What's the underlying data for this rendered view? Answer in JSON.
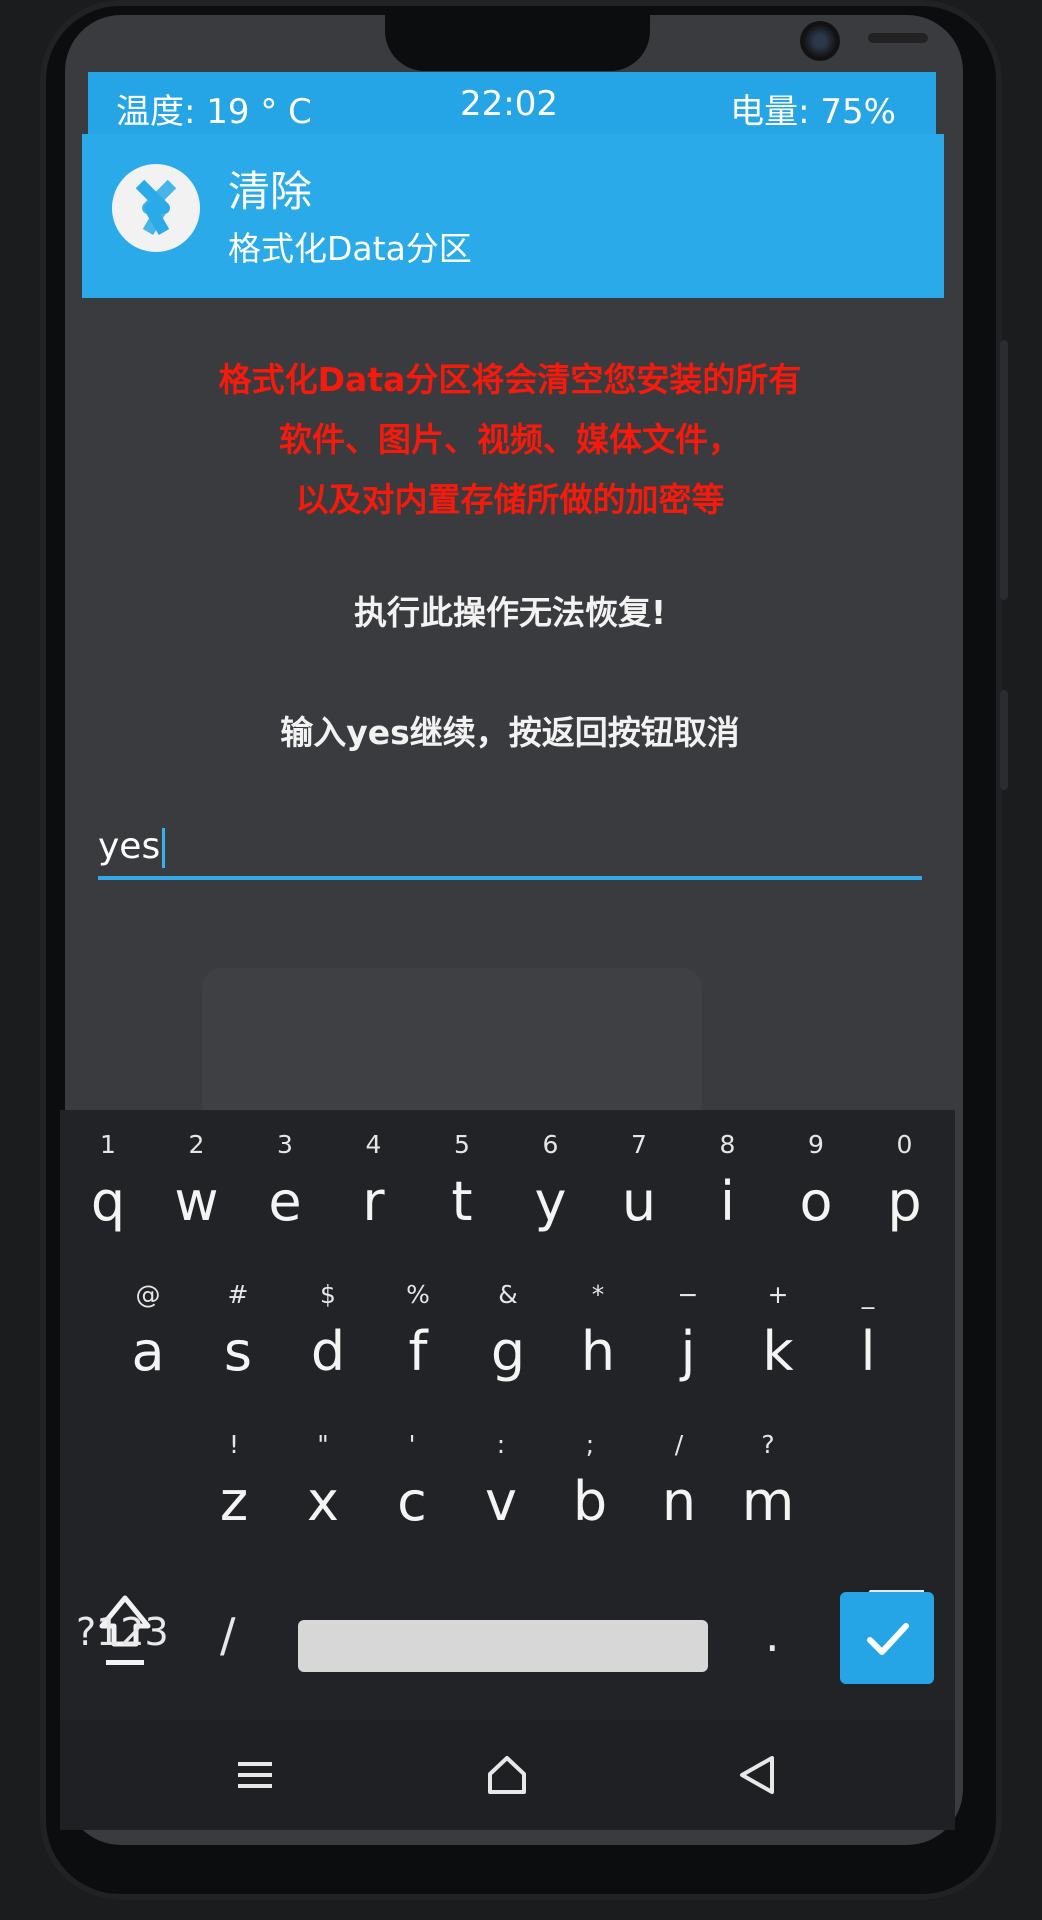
{
  "status_bar": {
    "temperature": "温度: 19 ° C",
    "time": "22:02",
    "battery": "电量: 75%"
  },
  "header": {
    "title": "清除",
    "subtitle": "格式化Data分区",
    "logo_icon": "twrp-logo-icon"
  },
  "content": {
    "warning_lines": [
      "格式化Data分区将会清空您安装的所有",
      "软件、图片、视频、媒体文件，",
      "以及对内置存储所做的加密等"
    ],
    "irreversible": "执行此操作无法恢复!",
    "instruction": "输入yes继续，按返回按钮取消",
    "input_value": "yes"
  },
  "keyboard": {
    "row1": [
      {
        "hint": "1",
        "key": "q"
      },
      {
        "hint": "2",
        "key": "w"
      },
      {
        "hint": "3",
        "key": "e"
      },
      {
        "hint": "4",
        "key": "r"
      },
      {
        "hint": "5",
        "key": "t"
      },
      {
        "hint": "6",
        "key": "y"
      },
      {
        "hint": "7",
        "key": "u"
      },
      {
        "hint": "8",
        "key": "i"
      },
      {
        "hint": "9",
        "key": "o"
      },
      {
        "hint": "0",
        "key": "p"
      }
    ],
    "row2": [
      {
        "hint": "@",
        "key": "a"
      },
      {
        "hint": "#",
        "key": "s"
      },
      {
        "hint": "$",
        "key": "d"
      },
      {
        "hint": "%",
        "key": "f"
      },
      {
        "hint": "&",
        "key": "g"
      },
      {
        "hint": "*",
        "key": "h"
      },
      {
        "hint": "−",
        "key": "j"
      },
      {
        "hint": "+",
        "key": "k"
      },
      {
        "hint": "_",
        "key": "l"
      }
    ],
    "row3": [
      {
        "hint": "!",
        "key": "z"
      },
      {
        "hint": "\"",
        "key": "x"
      },
      {
        "hint": "'",
        "key": "c"
      },
      {
        "hint": ":",
        "key": "v"
      },
      {
        "hint": ";",
        "key": "b"
      },
      {
        "hint": "/",
        "key": "n"
      },
      {
        "hint": "?",
        "key": "m"
      }
    ],
    "symbols_label": "?123",
    "slash_label": "/",
    "dot_label": ".",
    "accent_color": "#26a5e6"
  },
  "navbar": {
    "icons": [
      "menu-icon",
      "home-icon",
      "back-icon"
    ]
  },
  "colors": {
    "status_bar": "#26a5e6",
    "header": "#2aaae8",
    "warning_text": "#f51a0c",
    "background": "#3a3b3e"
  }
}
